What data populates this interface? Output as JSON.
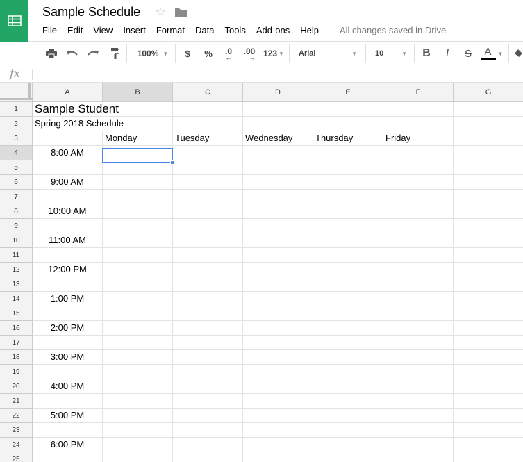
{
  "header": {
    "app_icon": "sheets-logo-icon",
    "title": "Sample Schedule",
    "star_icon": "star-icon",
    "folder_icon": "folder-icon",
    "menu": [
      "File",
      "Edit",
      "View",
      "Insert",
      "Format",
      "Data",
      "Tools",
      "Add-ons",
      "Help"
    ],
    "save_status": "All changes saved in Drive"
  },
  "toolbar": {
    "zoom": "100%",
    "currency": "$",
    "percent": "%",
    "decrease_decimal": ".0",
    "increase_decimal": ".00",
    "more_formats": "123",
    "font": "Arial",
    "font_size": "10",
    "bold": "B",
    "italic": "I",
    "strikethrough": "S",
    "text_color": "A",
    "text_color_value": "#000000"
  },
  "formula_bar": {
    "label": "fx",
    "value": ""
  },
  "grid": {
    "columns": [
      "A",
      "B",
      "C",
      "D",
      "E",
      "F",
      "G"
    ],
    "selected_column": "B",
    "selected_row": 4,
    "selected_cell": "B4",
    "rows": [
      "1",
      "2",
      "3",
      "4",
      "5",
      "6",
      "7",
      "8",
      "9",
      "10",
      "11",
      "12",
      "13",
      "14",
      "15",
      "16",
      "17",
      "18",
      "19",
      "20",
      "21",
      "22",
      "23",
      "24",
      "25"
    ],
    "cells": {
      "A1": "Sample Student",
      "A2": "Spring 2018 Schedule",
      "B3": "Monday",
      "C3": "Tuesday",
      "D3": "Wednesday ",
      "E3": "Thursday",
      "F3": "Friday",
      "A4": "8:00 AM",
      "A6": "9:00 AM",
      "A8": "10:00 AM",
      "A10": "11:00 AM",
      "A12": "12:00 PM",
      "A14": "1:00 PM",
      "A16": "2:00 PM",
      "A18": "3:00 PM",
      "A20": "4:00 PM",
      "A22": "5:00 PM",
      "A24": "6:00 PM"
    }
  },
  "colors": {
    "brand_green": "#23a566",
    "selection_blue": "#4a86e8"
  }
}
